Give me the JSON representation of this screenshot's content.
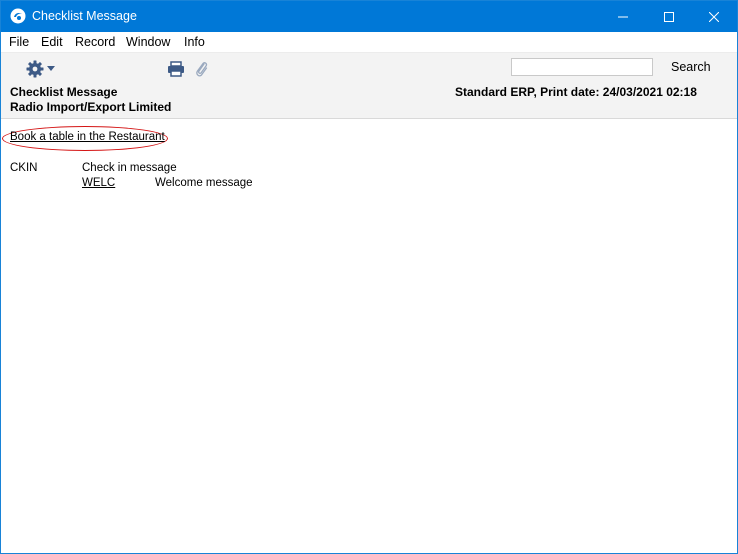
{
  "window": {
    "title": "Checklist Message",
    "accent_color": "#0078d7",
    "controls": [
      "minimize-icon",
      "maximize-icon",
      "close-icon"
    ]
  },
  "menu": {
    "items": [
      "File",
      "Edit",
      "Record",
      "Window",
      "Info"
    ]
  },
  "toolbar": {
    "icons": [
      "gear-icon",
      "chevron-down-icon",
      "print-icon",
      "paperclip-icon"
    ],
    "search_value": "",
    "search_label": "Search"
  },
  "report_header": {
    "title": "Checklist Message",
    "company": "Radio Import/Export Limited",
    "right_text": "Standard ERP, Print date: 24/03/2021 02:18"
  },
  "content": {
    "book_link": "Book a table in the Restaurant",
    "highlight_color": "#d41414",
    "rows": [
      {
        "code": "CKIN",
        "description": "Check in message"
      },
      {
        "code": "WELC",
        "description": "Welcome message"
      }
    ]
  }
}
